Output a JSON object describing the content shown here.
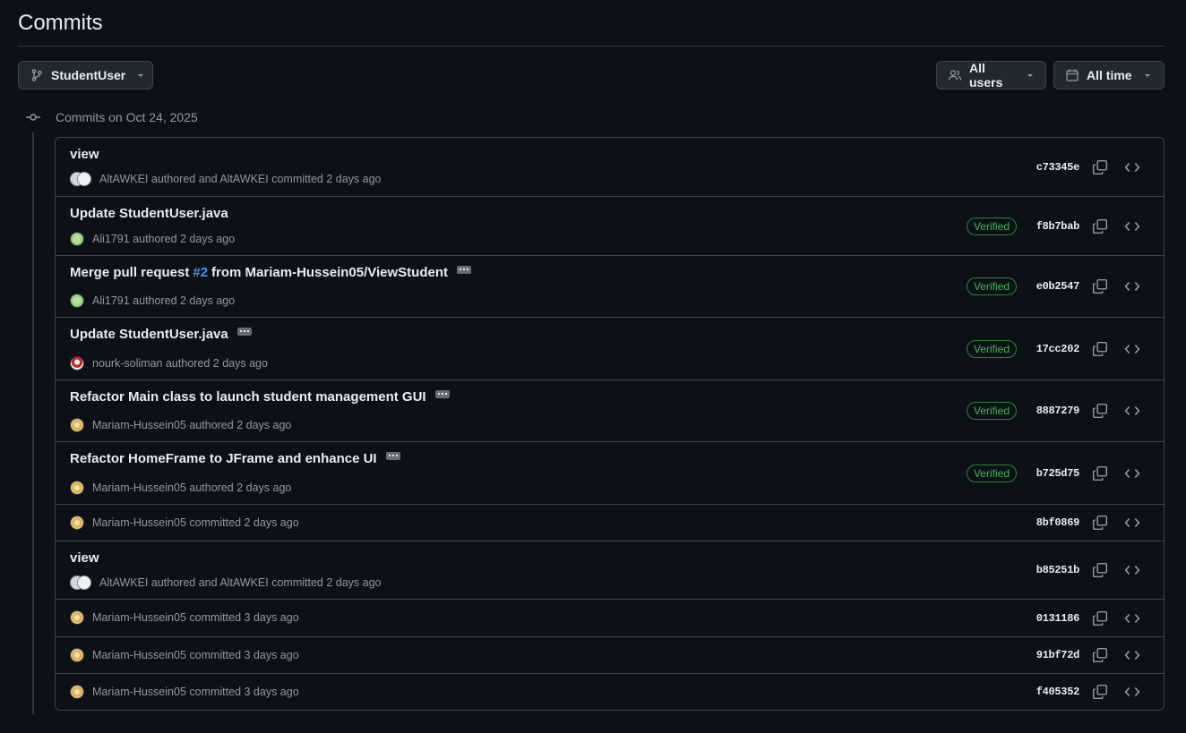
{
  "page": {
    "title": "Commits"
  },
  "toolbar": {
    "branch": "StudentUser",
    "users": "All users",
    "time": "All time"
  },
  "timeline": {
    "heading": "Commits on Oct 24, 2025"
  },
  "colors": {
    "background": "#0d1117",
    "verified": "#3fb950",
    "link": "#4493f8"
  },
  "commits": [
    {
      "message": "view",
      "author": "AltAWKEI authored and AltAWKEI committed 2 days ago",
      "sha": "c73345e",
      "verified": false,
      "avatar": "pair",
      "ellipsis": false
    },
    {
      "message": "Update StudentUser.java",
      "author": "Ali1791 authored 2 days ago",
      "sha": "f8b7bab",
      "verified": true,
      "avatar": "green",
      "ellipsis": false
    },
    {
      "message_pre": "Merge pull request",
      "message_link": "#2",
      "message_post": "from Mariam-Hussein05/ViewStudent",
      "author": "Ali1791 authored 2 days ago",
      "sha": "e0b2547",
      "verified": true,
      "avatar": "green",
      "ellipsis": true
    },
    {
      "message": "Update StudentUser.java",
      "author": "nourk-soliman authored 2 days ago",
      "sha": "17cc202",
      "verified": true,
      "avatar": "red",
      "ellipsis": true
    },
    {
      "message": "Refactor Main class to launch student management GUI",
      "author": "Mariam-Hussein05 authored 2 days ago",
      "sha": "8887279",
      "verified": true,
      "avatar": "gold",
      "ellipsis": true
    },
    {
      "message": "Refactor HomeFrame to JFrame and enhance UI",
      "author": "Mariam-Hussein05 authored 2 days ago",
      "sha": "b725d75",
      "verified": true,
      "avatar": "gold",
      "ellipsis": true
    },
    {
      "message": "",
      "author": "Mariam-Hussein05 committed 2 days ago",
      "sha": "8bf0869",
      "verified": false,
      "avatar": "gold",
      "ellipsis": false
    },
    {
      "message": "view",
      "author": "AltAWKEI authored and AltAWKEI committed 2 days ago",
      "sha": "b85251b",
      "verified": false,
      "avatar": "pair",
      "ellipsis": false
    },
    {
      "message": "",
      "author": "Mariam-Hussein05 committed 3 days ago",
      "sha": "0131186",
      "verified": false,
      "avatar": "gold",
      "ellipsis": false
    },
    {
      "message": "",
      "author": "Mariam-Hussein05 committed 3 days ago",
      "sha": "91bf72d",
      "verified": false,
      "avatar": "gold",
      "ellipsis": false
    },
    {
      "message": "",
      "author": "Mariam-Hussein05 committed 3 days ago",
      "sha": "f405352",
      "verified": false,
      "avatar": "gold",
      "ellipsis": false
    }
  ],
  "labels": {
    "verified": "Verified"
  }
}
